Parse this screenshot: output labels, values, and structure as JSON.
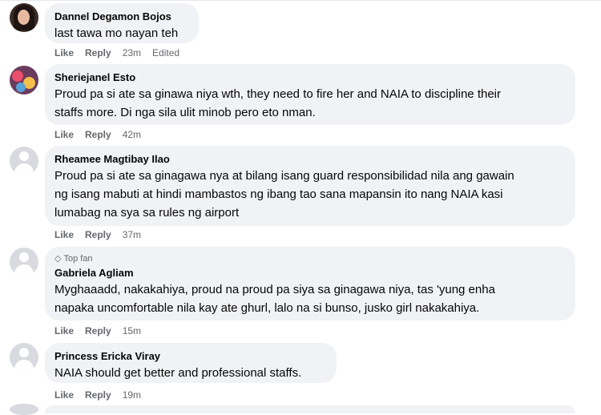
{
  "actions": {
    "like": "Like",
    "reply": "Reply"
  },
  "comments": [
    {
      "author": "Dannel Degamon Bojos",
      "text": "last tawa mo nayan teh",
      "time": "23m",
      "edited": "Edited"
    },
    {
      "author": "Sheriejanel Esto",
      "text_lines": [
        "Proud pa si ate sa ginawa niya wth, they need to fire her and NAIA to discipline their",
        "staffs more. Di nga sila ulit minob pero eto nman."
      ],
      "time": "42m"
    },
    {
      "author": "Rheamee Magtibay Ilao",
      "text_lines": [
        "Proud pa si ate sa ginagawa nya at bilang isang guard responsibilidad nila ang gawain",
        "ng isang mabuti at hindi mambastos ng ibang tao sana mapansin ito nang NAIA kasi",
        "lumabag na sya sa rules ng airport"
      ],
      "time": "37m"
    },
    {
      "badge": "Top fan",
      "author": "Gabriela Agliam",
      "text_lines": [
        "Myghaaadd, nakakahiya, proud na proud pa siya sa ginagawa niya, tas 'yung enha",
        "napaka uncomfortable nila kay ate ghurl, lalo na si bunso, jusko girl nakakahiya."
      ],
      "time": "15m"
    },
    {
      "author": "Princess Ericka Viray",
      "text": "NAIA should get better and professional staffs.",
      "time": "19m"
    }
  ]
}
